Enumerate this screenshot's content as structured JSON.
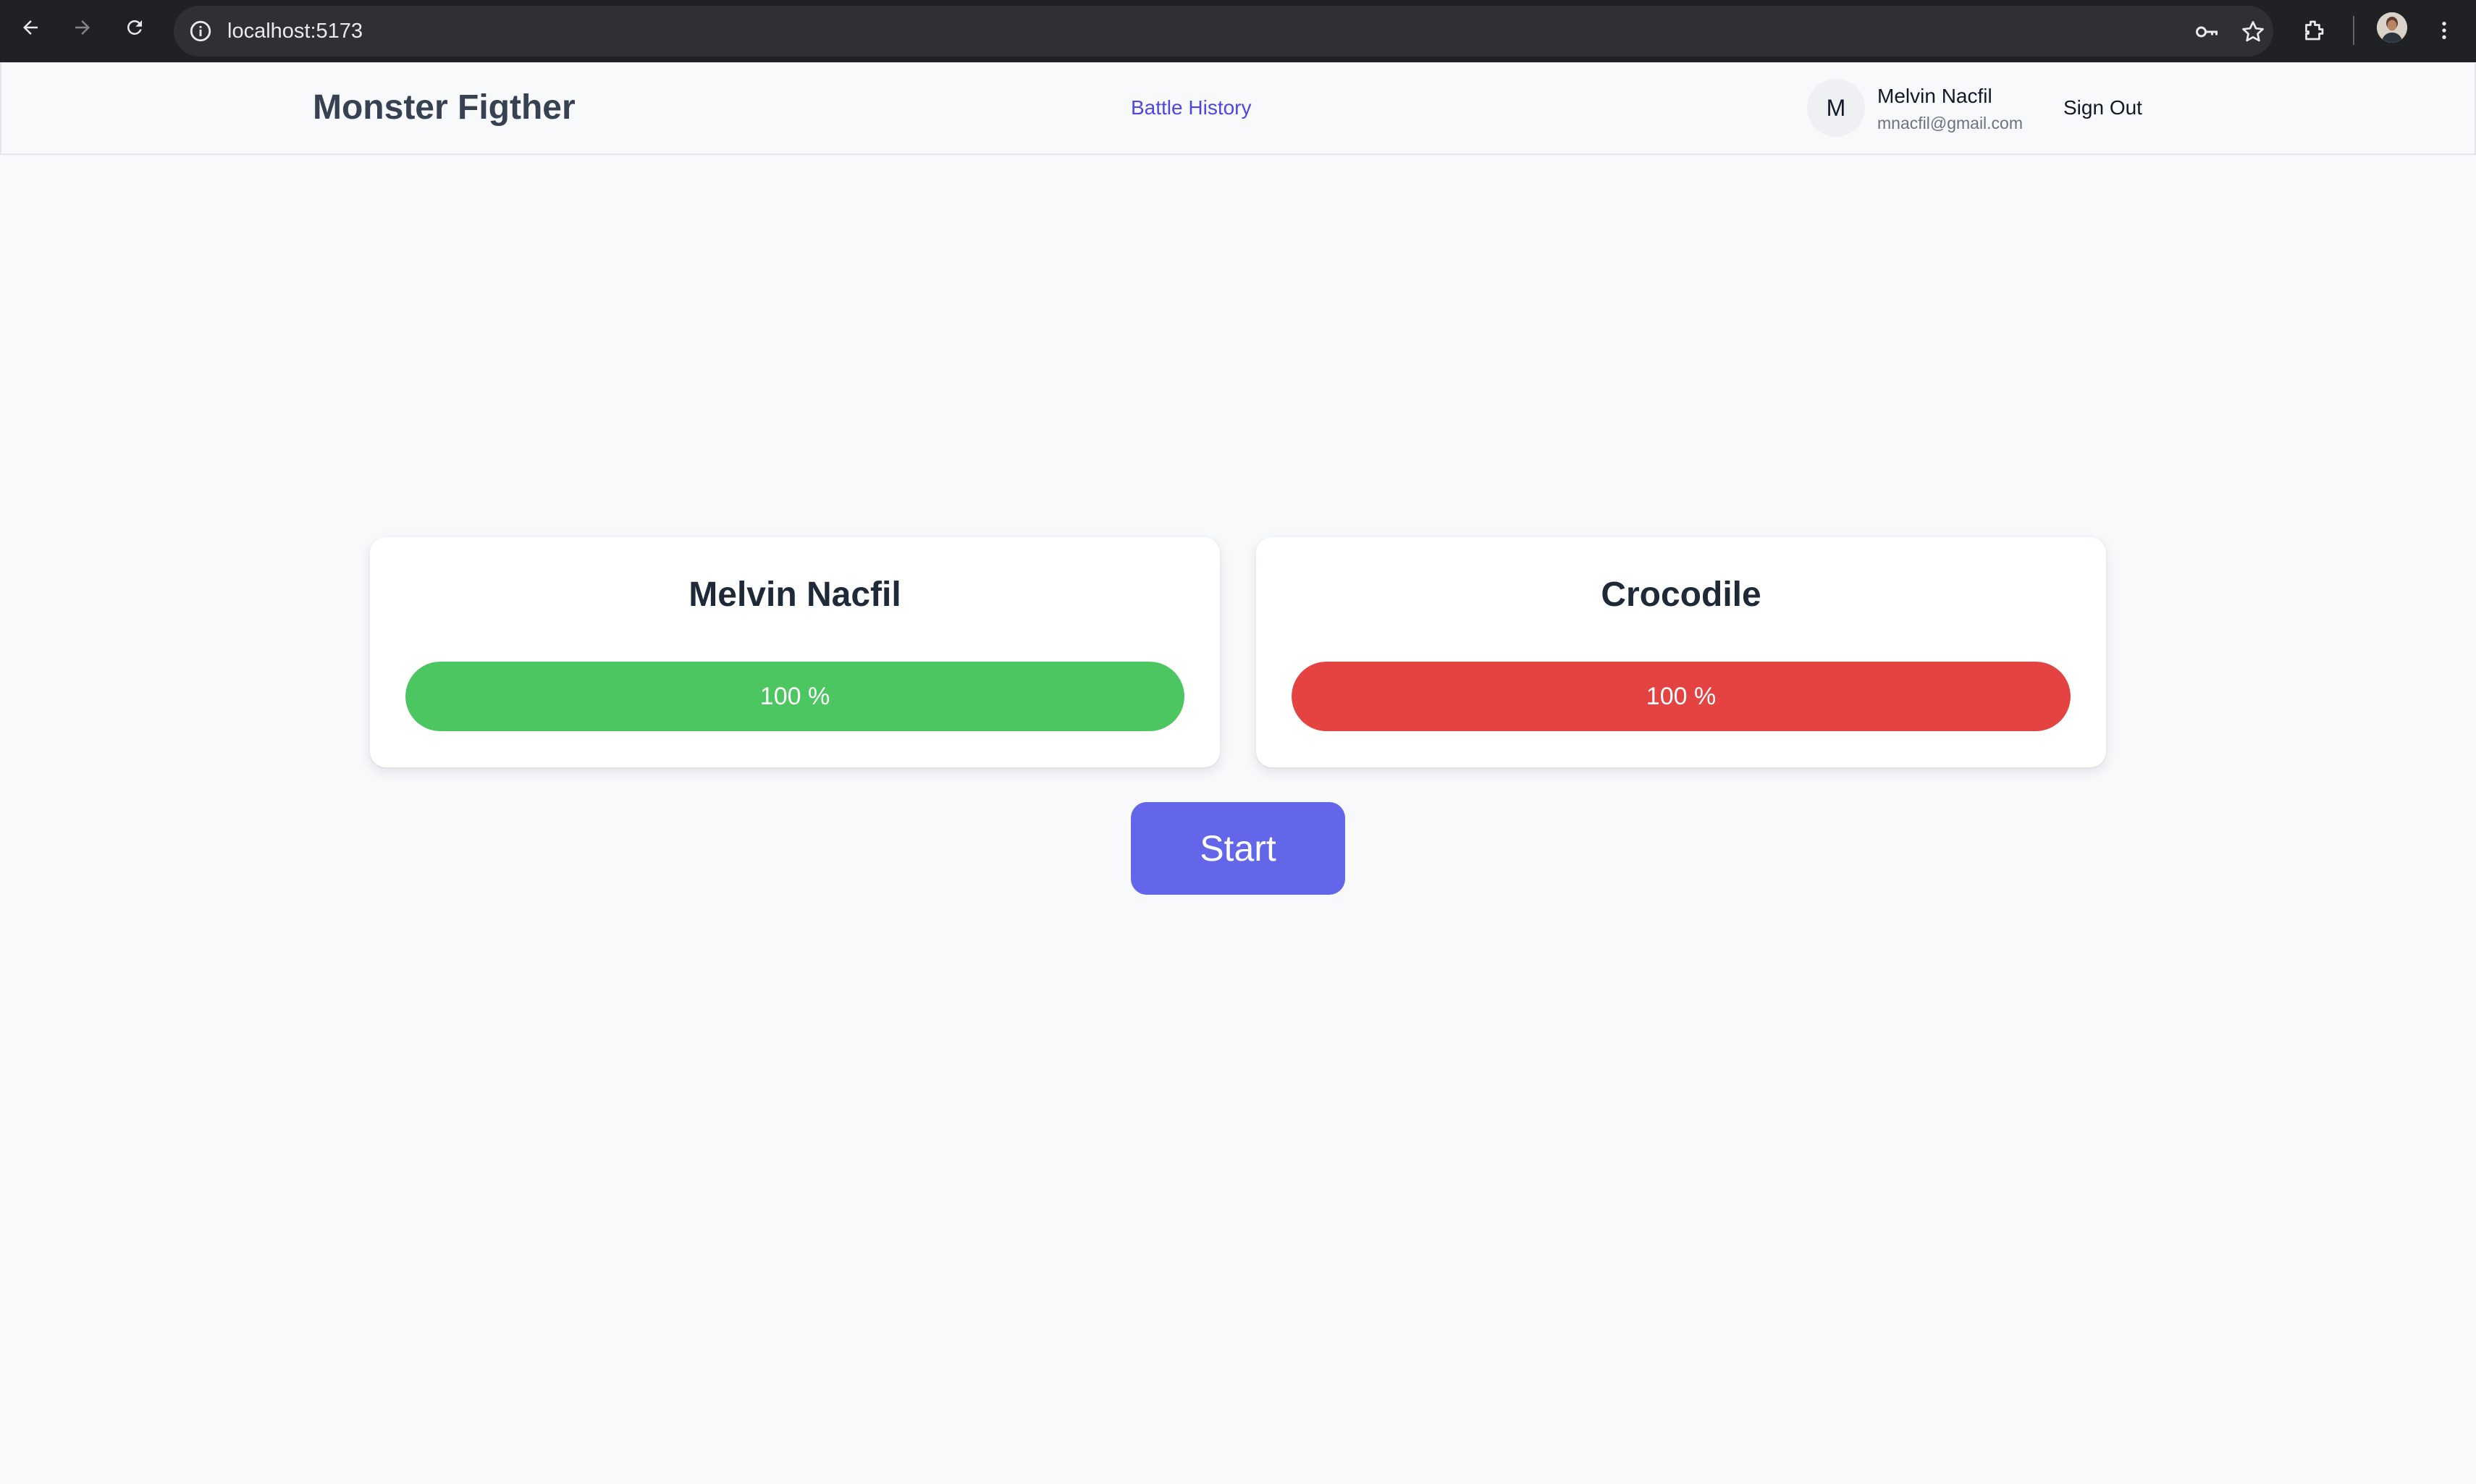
{
  "browser": {
    "url": "localhost:5173",
    "icons": [
      "back-arrow-icon",
      "forward-arrow-icon",
      "reload-icon",
      "site-info-icon",
      "key-icon",
      "star-icon",
      "extensions-icon",
      "profile-avatar",
      "more-menu-icon"
    ]
  },
  "header": {
    "brand": "Monster Figther",
    "nav_link": "Battle History",
    "avatar_initial": "M",
    "user_name": "Melvin Nacfil",
    "user_email": "mnacfil@gmail.com",
    "sign_out_label": "Sign Out"
  },
  "battle": {
    "player": {
      "name": "Melvin Nacfil",
      "health_percent": 100,
      "health_label": "100 %",
      "color": "#4cc660"
    },
    "opponent": {
      "name": "Crocodile",
      "health_percent": 100,
      "health_label": "100 %",
      "color": "#e54242"
    },
    "start_label": "Start"
  },
  "colors": {
    "accent": "#6366e8",
    "link": "#4f46e5",
    "background": "#f8f9fb"
  }
}
